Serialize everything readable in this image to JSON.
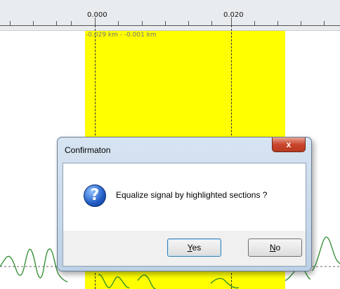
{
  "ruler": {
    "tick_labels": [
      "0.000",
      "0.020"
    ]
  },
  "selection": {
    "range_label": "-0.029 km - -0.001 km",
    "highlight_color": "#ffff00"
  },
  "waveform": {
    "color": "#2e8b2e"
  },
  "dialog": {
    "title": "Confirmaton",
    "close_glyph": "x",
    "icon": "question-icon",
    "icon_glyph": "?",
    "message": "Equalize signal by highlighted sections ?",
    "yes_mnemonic": "Y",
    "yes_rest": "es",
    "no_mnemonic": "N",
    "no_rest": "o"
  }
}
